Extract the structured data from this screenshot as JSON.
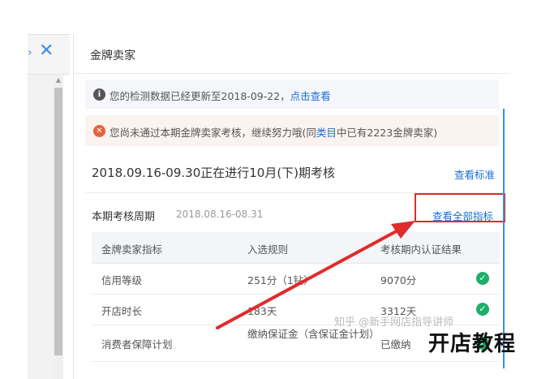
{
  "left_panel": {
    "close_glyph": "✕"
  },
  "title": "金牌卖家",
  "notice_update": {
    "text": "您的检测数据已经更新至2018-09-22，",
    "link": "点击查看"
  },
  "notice_failed": {
    "text_before": "您尚未通过本期金牌卖家考核，继续努力哦(同",
    "link": "类目",
    "text_after": "中已有2223金牌卖家)"
  },
  "assessment": {
    "period_text": "2018.09.16-09.30正在进行10月(下)期考核",
    "view_standard": "查看标准"
  },
  "cycle": {
    "label": "本期考核周期",
    "dates": "2018.08.16-08.31",
    "view_all": "查看全部指标"
  },
  "table": {
    "headers": [
      "金牌卖家指标",
      "入选规则",
      "考核期内认证结果"
    ],
    "rows": [
      {
        "metric": "信用等级",
        "rule": "251分（1钻）",
        "result": "9070分",
        "passed": true
      },
      {
        "metric": "开店时长",
        "rule": "183天",
        "result": "3312天",
        "passed": true
      },
      {
        "metric": "消费者保障计划",
        "rule": "缴纳保证金（含保证金计划）",
        "result": "已缴纳",
        "passed": true
      }
    ]
  },
  "watermark": "知乎 @新手网店指导讲师",
  "brand": "开店教程",
  "colors": {
    "link": "#1a6fd1",
    "highlight": "#e02b2b",
    "ok": "#1fae6a",
    "error": "#e4633c"
  },
  "icons": {
    "info": "info-icon",
    "error": "error-icon",
    "ok": "check-icon",
    "close": "close-icon"
  }
}
